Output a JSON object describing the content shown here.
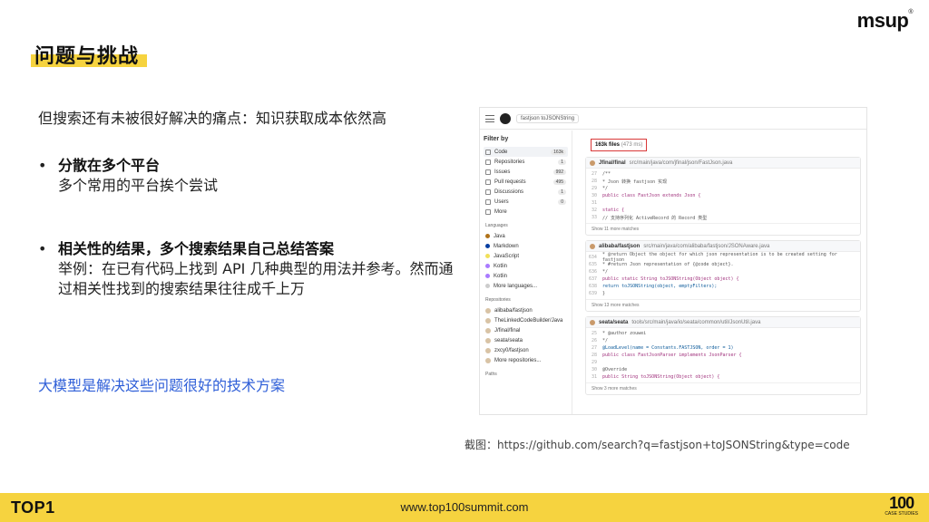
{
  "brand": {
    "logo": "msup",
    "reg_mark": "®"
  },
  "title": "问题与挑战",
  "content": {
    "intro": "但搜索还有未被很好解决的痛点：知识获取成本依然高",
    "bullets": [
      {
        "heading": "分散在多个平台",
        "body": "多个常用的平台挨个尝试"
      },
      {
        "heading": "相关性的结果，多个搜索结果自己总结答案",
        "body": "举例：在已有代码上找到 API 几种典型的用法并参考。然而通过相关性找到的搜索结果往往成千上万"
      }
    ],
    "highlight": "大模型是解决这些问题很好的技术方案",
    "bullet_symbol": "•"
  },
  "screenshot": {
    "search_query": "fastjson toJSONString",
    "filter_title": "Filter by",
    "filters": [
      {
        "label": "Code",
        "count": "163k",
        "active": true
      },
      {
        "label": "Repositories",
        "count": "1"
      },
      {
        "label": "Issues",
        "count": "992"
      },
      {
        "label": "Pull requests",
        "count": "495"
      },
      {
        "label": "Discussions",
        "count": "1"
      },
      {
        "label": "Users",
        "count": "0"
      },
      {
        "label": "More",
        "count": ""
      }
    ],
    "languages_title": "Languages",
    "languages": [
      {
        "label": "Java",
        "color": "#b07219"
      },
      {
        "label": "Markdown",
        "color": "#083fa1"
      },
      {
        "label": "JavaScript",
        "color": "#f1e05a"
      },
      {
        "label": "Kotlin",
        "color": "#a97bff"
      },
      {
        "label": "Kotlin",
        "color": "#a97bff"
      },
      {
        "label": "More languages...",
        "color": "#cccccc"
      }
    ],
    "repos_title": "Repositories",
    "repos": [
      {
        "label": "alibaba/fastjson"
      },
      {
        "label": "TheLinkedCodeBuilder/Java"
      },
      {
        "label": "J/final/final"
      },
      {
        "label": "seata/seata"
      },
      {
        "label": "zxcy0/fastjson"
      },
      {
        "label": "More repositories..."
      }
    ],
    "paths_title": "Paths",
    "result_count": "163k files",
    "result_time": "(473 ms)",
    "files": [
      {
        "repo": "Jfinal/final",
        "path": "src/main/java/com/jfinal/json/FastJson.java",
        "lines": [
          {
            "n": "27",
            "t": "/**",
            "style": ""
          },
          {
            "n": "28",
            "t": " * Json 转换 fastjson 实现",
            "style": ""
          },
          {
            "n": "29",
            "t": " */",
            "style": ""
          },
          {
            "n": "30",
            "t": "public class FastJson extends Json {",
            "style": "kw"
          },
          {
            "n": "31",
            "t": "",
            "style": ""
          },
          {
            "n": "32",
            "t": "    static {",
            "style": "kw"
          },
          {
            "n": "33",
            "t": "        // 支持序列化 ActiveRecord 的 Record 类型",
            "style": ""
          }
        ],
        "more": "Show 11 more matches"
      },
      {
        "repo": "alibaba/fastjson",
        "path": "src/main/java/com/alibaba/fastjson/JSONAware.java",
        "lines": [
          {
            "n": "634",
            "t": "    * @return Object the object for which json representation is to be created setting for fastjson",
            "style": ""
          },
          {
            "n": "635",
            "t": "    * #return Json representation of {@code object}.",
            "style": ""
          },
          {
            "n": "636",
            "t": "    */",
            "style": ""
          },
          {
            "n": "637",
            "t": "    public static String toJSONString(Object object) {",
            "style": "kw"
          },
          {
            "n": "638",
            "t": "        return toJSONString(object, emptyFilters);",
            "style": "hl"
          },
          {
            "n": "639",
            "t": "    }",
            "style": ""
          }
        ],
        "more": "Show 13 more matches"
      },
      {
        "repo": "seata/seata",
        "path": "tools/src/main/java/io/seata/common/util/JsonUtil.java",
        "lines": [
          {
            "n": "25",
            "t": " * @author zouwei",
            "style": ""
          },
          {
            "n": "26",
            "t": " */",
            "style": ""
          },
          {
            "n": "27",
            "t": "@LoadLevel(name = Constants.FASTJSON, order = 1)",
            "style": "hl"
          },
          {
            "n": "28",
            "t": "public class FastJsonParser implements JsonParser {",
            "style": "kw"
          },
          {
            "n": "29",
            "t": "",
            "style": ""
          },
          {
            "n": "30",
            "t": "    @Override",
            "style": ""
          },
          {
            "n": "31",
            "t": "    public String toJSONString(Object object) {",
            "style": "kw"
          }
        ],
        "more": "Show 3 more matches"
      }
    ]
  },
  "caption": "截图：https://github.com/search?q=fastjson+toJSONString&type=code",
  "footer": {
    "logo": "TOP1",
    "url": "www.top100summit.com",
    "mark_big": "100",
    "mark_small": "CASE STUDIES"
  }
}
